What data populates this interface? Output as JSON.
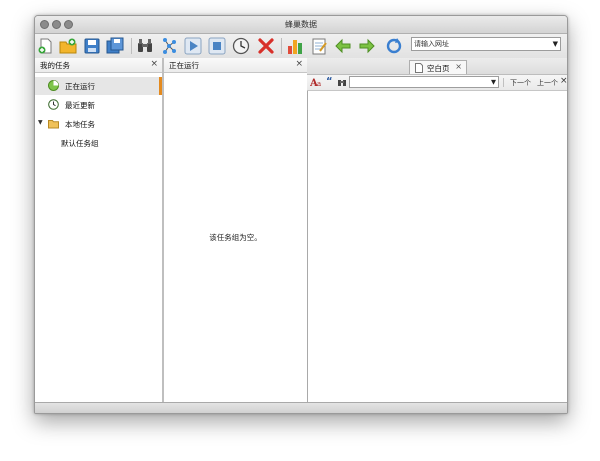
{
  "window": {
    "title": "蜂巢数据"
  },
  "toolbar": {
    "buttons": [
      {
        "name": "new-file-icon"
      },
      {
        "name": "open-folder-icon"
      },
      {
        "name": "save-icon"
      },
      {
        "name": "save-all-icon"
      },
      {
        "name": "binoculars-icon"
      },
      {
        "name": "network-icon"
      },
      {
        "name": "play-icon"
      },
      {
        "name": "stop-icon"
      },
      {
        "name": "clock-icon"
      },
      {
        "name": "delete-icon"
      },
      {
        "name": "bar-chart-icon"
      },
      {
        "name": "notepad-icon"
      },
      {
        "name": "back-arrow-icon"
      },
      {
        "name": "forward-arrow-icon"
      },
      {
        "name": "refresh-icon"
      }
    ],
    "url_placeholder": "请输入网址"
  },
  "sidebar": {
    "title": "我的任务",
    "close": "×",
    "items": [
      {
        "label": "正在运行",
        "icon": "running-icon",
        "selected": true
      },
      {
        "label": "最近更新",
        "icon": "recent-clock-icon"
      },
      {
        "label": "本地任务",
        "icon": "folder-icon",
        "expanded": true
      },
      {
        "label": "默认任务组",
        "icon": ""
      }
    ]
  },
  "middle": {
    "title": "正在运行",
    "close": "×",
    "empty_message": "该任务组为空。"
  },
  "browser": {
    "tab_label": "空白页",
    "tab_close": "×",
    "find": {
      "value": "",
      "next": "下一个",
      "prev": "上一个",
      "close": "×"
    }
  }
}
